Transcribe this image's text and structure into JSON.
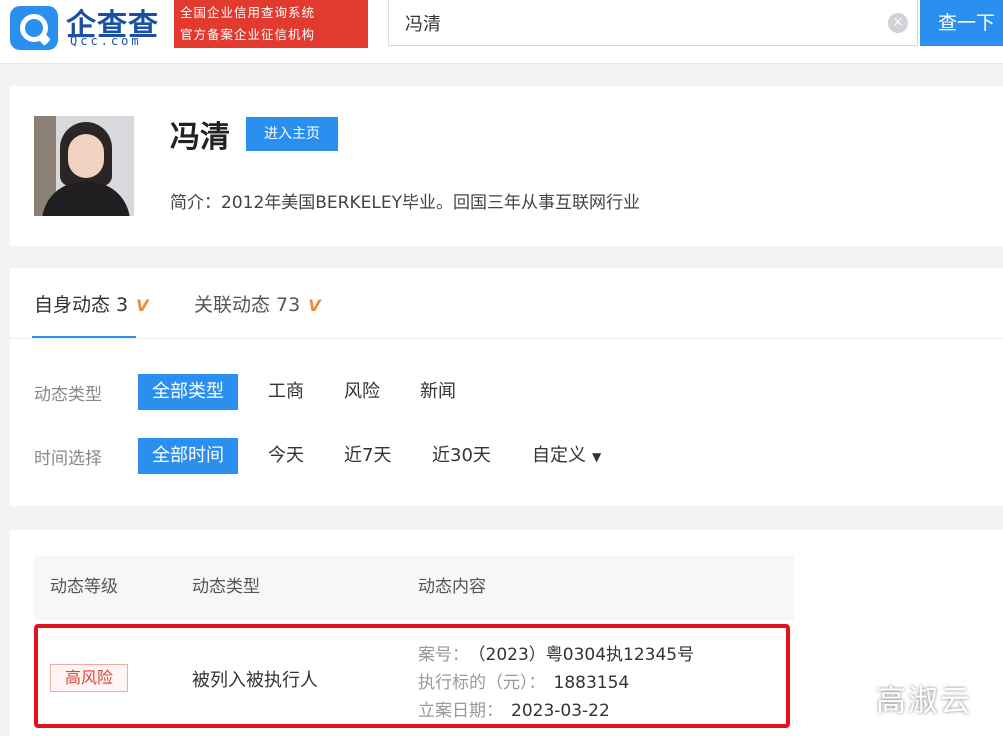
{
  "header": {
    "logo_name": "企查查",
    "logo_sub": "Qcc.com",
    "slogan_line1": "全国企业信用查询系统",
    "slogan_line2": "官方备案企业征信机构",
    "search_value": "冯清",
    "clear_icon": "×",
    "search_button": "查一下"
  },
  "profile": {
    "name": "冯清",
    "home_button": "进入主页",
    "intro": "简介：2012年美国BERKELEY毕业。回国三年从事互联网行业"
  },
  "tabs": [
    {
      "label": "自身动态",
      "count": "3",
      "icon": "V"
    },
    {
      "label": "关联动态",
      "count": "73",
      "icon": "V"
    }
  ],
  "filters": {
    "type_label": "动态类型",
    "type_options": [
      "全部类型",
      "工商",
      "风险",
      "新闻"
    ],
    "time_label": "时间选择",
    "time_options": [
      "全部时间",
      "今天",
      "近7天",
      "近30天",
      "自定义"
    ]
  },
  "table": {
    "headers": [
      "动态等级",
      "动态类型",
      "动态内容"
    ],
    "row": {
      "level": "高风险",
      "type": "被列入被执行人",
      "case_no_label": "案号：",
      "case_no": "（2023）粤0304执12345号",
      "amount_label": "执行标的（元）：",
      "amount": "1883154",
      "date_label": "立案日期：",
      "date": "2023-03-22"
    }
  },
  "watermark": "高淑云",
  "colors": {
    "accent": "#2b8ff0",
    "slogan_bg": "#e23a2f",
    "highlight": "#e0141c",
    "risk": "#d9443a"
  }
}
